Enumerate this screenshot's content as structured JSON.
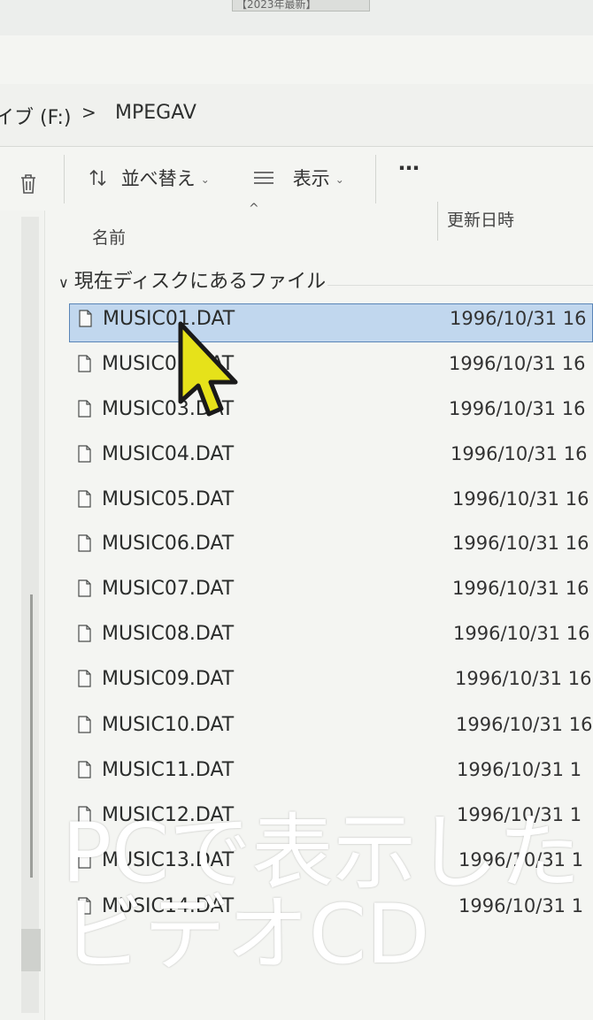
{
  "top_tab_text": "【2023年最新】",
  "breadcrumb": {
    "drive_label": "イブ (F:)",
    "separator": ">",
    "folder_label": "MPEGAV"
  },
  "toolbar": {
    "delete_icon": "trash-icon",
    "sort_icon": "sort-arrows-icon",
    "sort_label": "並べ替え",
    "view_icon": "list-lines-icon",
    "view_label": "表示",
    "more_label": "…"
  },
  "columns": {
    "name_label": "名前",
    "date_label": "更新日時",
    "sort_caret": "^"
  },
  "group": {
    "chevron": "∨",
    "label": "現在ディスクにあるファイル"
  },
  "files": [
    {
      "name": "MUSIC01.DAT",
      "date": "1996/10/31 16"
    },
    {
      "name": "MUSIC02.DAT",
      "date": "1996/10/31 16"
    },
    {
      "name": "MUSIC03.DAT",
      "date": "1996/10/31 16"
    },
    {
      "name": "MUSIC04.DAT",
      "date": "1996/10/31 16"
    },
    {
      "name": "MUSIC05.DAT",
      "date": "1996/10/31 16"
    },
    {
      "name": "MUSIC06.DAT",
      "date": "1996/10/31 16"
    },
    {
      "name": "MUSIC07.DAT",
      "date": "1996/10/31 16"
    },
    {
      "name": "MUSIC08.DAT",
      "date": "1996/10/31 16"
    },
    {
      "name": "MUSIC09.DAT",
      "date": "1996/10/31 16"
    },
    {
      "name": "MUSIC10.DAT",
      "date": "1996/10/31 16"
    },
    {
      "name": "MUSIC11.DAT",
      "date": "1996/10/31 1"
    },
    {
      "name": "MUSIC12.DAT",
      "date": "1996/10/31 1"
    },
    {
      "name": "MUSIC13.DAT",
      "date": "1996/10/31 1"
    },
    {
      "name": "MUSIC14.DAT",
      "date": "1996/10/31 1"
    }
  ],
  "selected_index": 0,
  "overlay_caption": {
    "line1": "PCで表示した",
    "line2": "ビデオCD"
  },
  "colors": {
    "selection": "#c1d7ee",
    "selection_border": "#5a85b7",
    "cursor_fill": "#e6e21a"
  }
}
